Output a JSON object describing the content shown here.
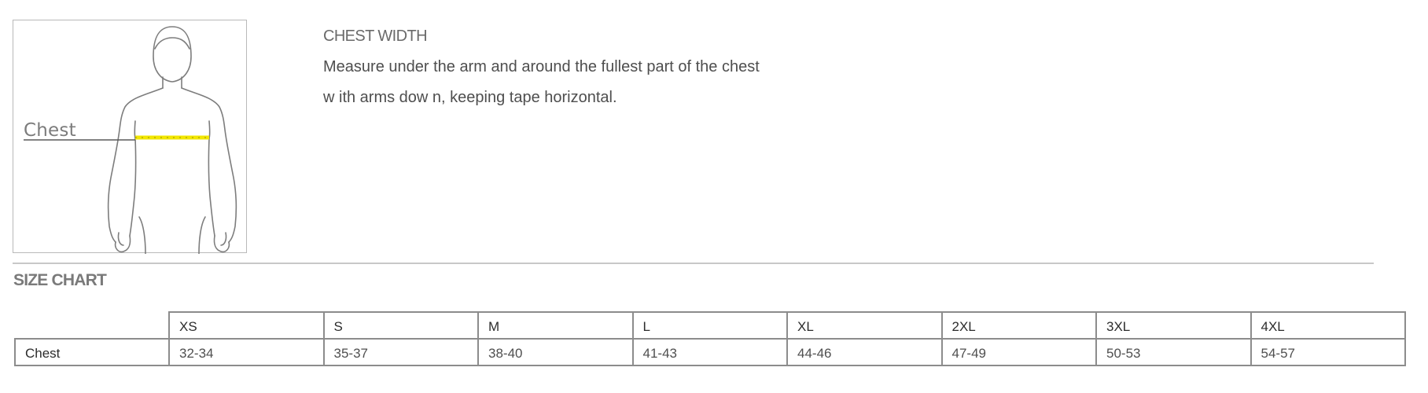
{
  "figure": {
    "label": "Chest"
  },
  "instructions": {
    "title": "CHEST WIDTH",
    "line1": "Measure under the arm and around the fullest part of the chest",
    "line2": "w ith arms dow n, keeping tape horizontal."
  },
  "size_chart": {
    "title": "SIZE CHART",
    "sizes": [
      "XS",
      "S",
      "M",
      "L",
      "XL",
      "2XL",
      "3XL",
      "4XL"
    ],
    "rows": [
      {
        "label": "Chest",
        "values": [
          "32-34",
          "35-37",
          "38-40",
          "41-43",
          "44-46",
          "47-49",
          "50-53",
          "54-57"
        ]
      }
    ]
  },
  "colors": {
    "tape": "#f2e600",
    "outline": "#7d7d7d",
    "border": "#8c8c8c"
  }
}
